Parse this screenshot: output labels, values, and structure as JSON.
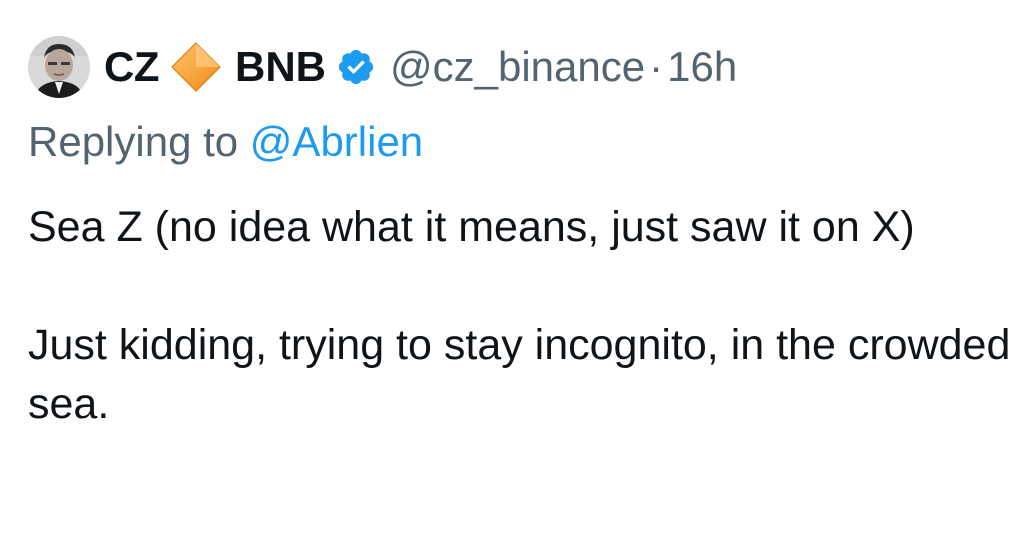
{
  "tweet": {
    "author": {
      "display_name": "CZ",
      "affiliation": "BNB",
      "handle": "@cz_binance",
      "verified": true,
      "badge_icon": "orange-diamond-icon",
      "verified_icon": "blue-verified-badge-icon",
      "badge_color": "#f7931a",
      "verified_color": "#1d9bf0"
    },
    "separator": "·",
    "time": "16h",
    "reply": {
      "prefix": "Replying to",
      "handle": "@Abrlien"
    },
    "paragraphs": [
      "Sea Z (no idea what it means, just saw it on X)",
      "Just kidding, trying to stay incognito, in the crowded sea."
    ]
  },
  "colors": {
    "text_primary": "#0f1419",
    "text_secondary": "#536471",
    "link": "#1d9bf0",
    "background": "#ffffff"
  }
}
